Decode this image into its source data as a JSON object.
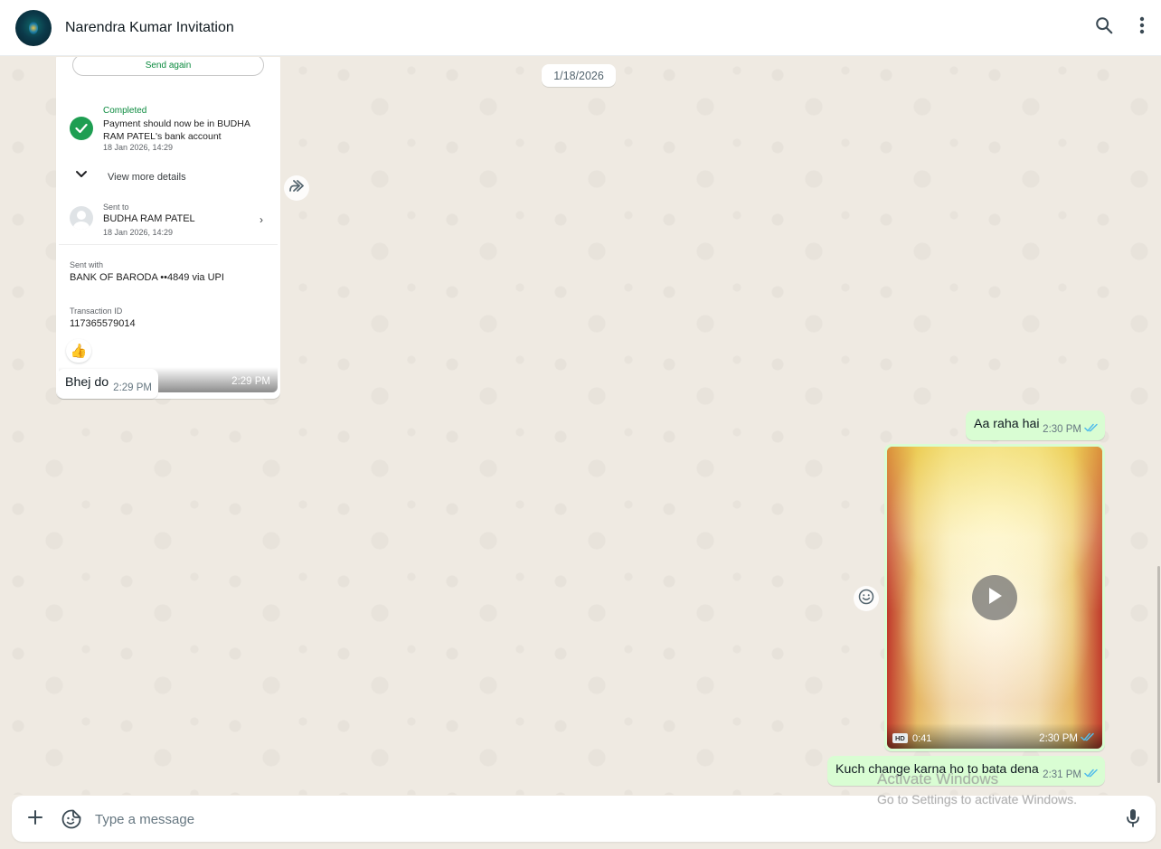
{
  "header": {
    "title": "Narendra Kumar Invitation"
  },
  "date_chip": "1/18/2026",
  "payment_image": {
    "send_again": "Send again",
    "status": "Completed",
    "message": "Payment should now be in BUDHA RAM PATEL's bank account",
    "completed_date": "18 Jan 2026, 14:29",
    "more_details": "View more details",
    "sent_to_label": "Sent to",
    "recipient": "BUDHA RAM PATEL",
    "recipient_date": "18 Jan 2026, 14:29",
    "sent_with_label": "Sent with",
    "bank": "BANK OF BARODA ••4849 via UPI",
    "txn_label": "Transaction ID",
    "txn_id": "117365579014",
    "time": "2:29 PM"
  },
  "reaction": "👍",
  "messages": [
    {
      "text": "Bhej do",
      "time": "2:29 PM",
      "direction": "in"
    },
    {
      "text": "Aa raha hai",
      "time": "2:30 PM",
      "direction": "out"
    },
    {
      "text": "Kuch change karna ho to bata dena",
      "time": "2:31 PM",
      "direction": "out"
    }
  ],
  "video": {
    "badge": "HD",
    "duration": "0:41",
    "time": "2:30 PM"
  },
  "composer": {
    "placeholder": "Type a message"
  },
  "watermark": {
    "line1": "Activate Windows",
    "line2": "Go to Settings to activate Windows."
  },
  "colors": {
    "chat_bg": "#efeae2",
    "outgoing_bubble": "#d9fdd3",
    "incoming_bubble": "#ffffff",
    "read_ticks": "#53bdeb",
    "success_green": "#1e9e52"
  },
  "icons": {
    "search": "search-icon",
    "menu": "more-vertical-icon",
    "forward": "forward-icon",
    "play": "play-icon",
    "emoji_react": "emoji-icon",
    "attach": "plus-icon",
    "sticker": "sticker-icon",
    "mic": "mic-icon"
  }
}
